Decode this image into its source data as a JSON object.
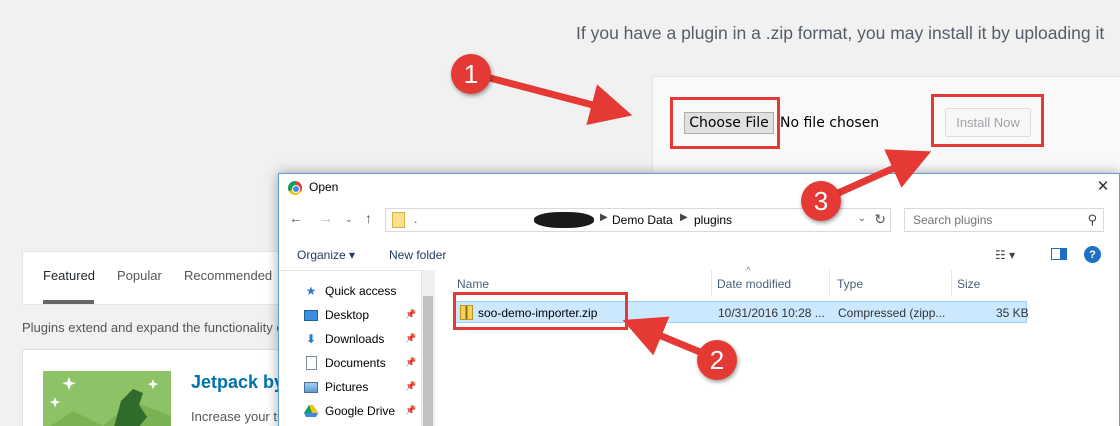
{
  "wp": {
    "intro": "If you have a plugin in a .zip format, you may install it by uploading it",
    "choose_file": "Choose File",
    "no_file": "No file chosen",
    "install_now": "Install Now",
    "tabs": [
      "Featured",
      "Popular",
      "Recommended"
    ],
    "plugins_desc": "Plugins extend and expand the functionality of",
    "plugin_name": "Jetpack by",
    "plugin_desc": "Increase your tr"
  },
  "dialog": {
    "title": "Open",
    "addr_dot": ".",
    "crumbs": [
      "Demo Data",
      "plugins"
    ],
    "search_placeholder": "Search plugins",
    "organize": "Organize ▾",
    "new_folder": "New folder",
    "nav_items": [
      "Quick access",
      "Desktop",
      "Downloads",
      "Documents",
      "Pictures",
      "Google Drive"
    ],
    "columns": [
      "Name",
      "Date modified",
      "Type",
      "Size"
    ],
    "file": {
      "name": "soo-demo-importer.zip",
      "date": "10/31/2016 10:28 ...",
      "type": "Compressed (zipp...",
      "size": "35 KB"
    }
  },
  "annotations": [
    "1",
    "2",
    "3"
  ],
  "colors": {
    "annotation": "#e53935",
    "selection": "#cce8ff",
    "link": "#0073aa"
  }
}
